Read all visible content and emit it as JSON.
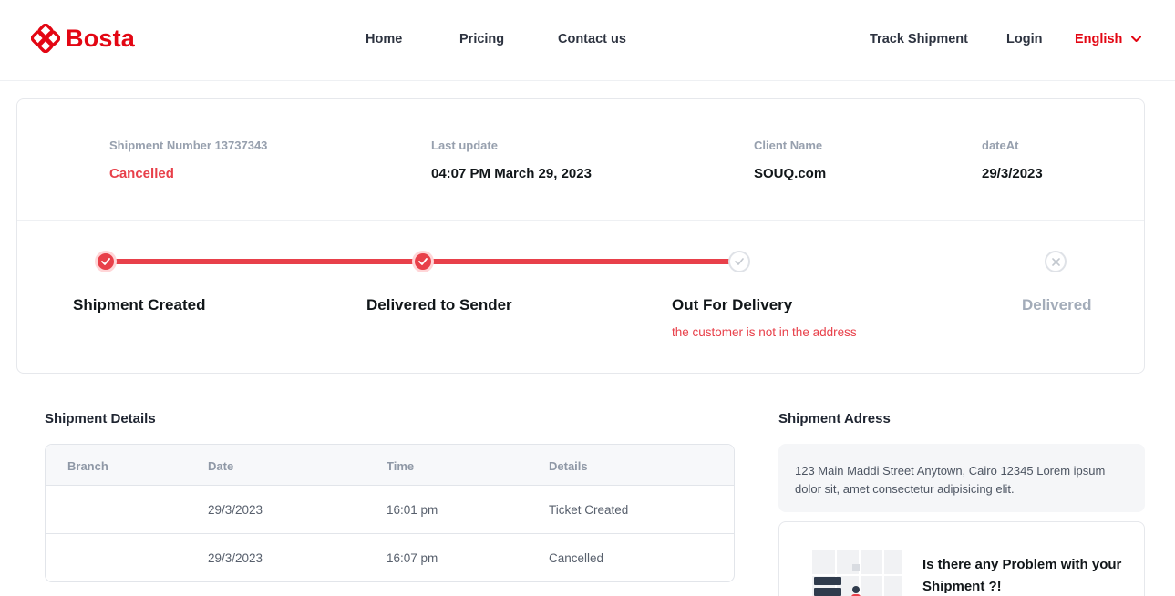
{
  "brand": {
    "name": "Bosta",
    "color": "#e30613"
  },
  "nav": {
    "home": "Home",
    "pricing": "Pricing",
    "contact": "Contact us",
    "track": "Track Shipment",
    "login": "Login",
    "language": "English"
  },
  "shipment": {
    "number_label": "Shipment Number 13737343",
    "status": "Cancelled",
    "last_update_label": "Last update",
    "last_update_value": "04:07 PM March 29, 2023",
    "client_label": "Client Name",
    "client_value": "SOUQ.com",
    "date_label": "dateAt",
    "date_value": "29/3/2023"
  },
  "tracker": {
    "progress_completed_steps": 2,
    "steps": [
      {
        "label": "Shipment Created",
        "state": "done",
        "icon": "check-icon"
      },
      {
        "label": "Delivered to Sender",
        "state": "done",
        "icon": "check-icon"
      },
      {
        "label": "Out For Delivery",
        "state": "pending",
        "icon": "check-icon",
        "note": "the customer is not in the address"
      },
      {
        "label": "Delivered",
        "state": "cancelled",
        "icon": "x-icon"
      }
    ],
    "colors": {
      "active": "#e8404a",
      "inactive": "#e4e6ea"
    }
  },
  "details": {
    "title": "Shipment Details",
    "columns": [
      "Branch",
      "Date",
      "Time",
      "Details"
    ],
    "rows": [
      {
        "branch": "",
        "date": "29/3/2023",
        "time": "16:01 pm",
        "details": "Ticket Created"
      },
      {
        "branch": "",
        "date": "29/3/2023",
        "time": "16:07 pm",
        "details": "Cancelled"
      }
    ]
  },
  "address": {
    "title": "Shipment Adress",
    "text": "123 Main Maddi Street Anytown, Cairo 12345 Lorem ipsum dolor sit, amet consectetur adipisicing elit."
  },
  "problem": {
    "text": "Is there any Problem with your Shipment ?!"
  }
}
